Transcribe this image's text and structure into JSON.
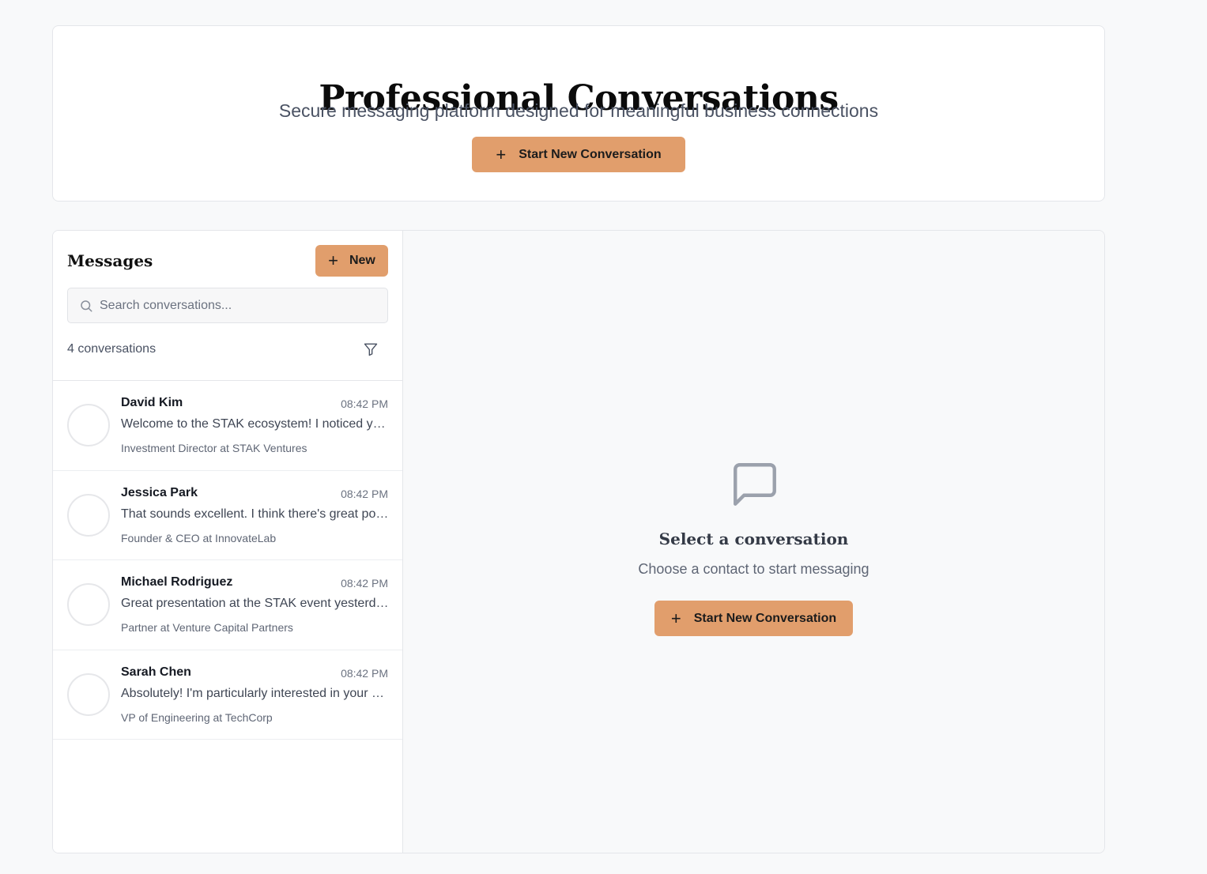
{
  "hero": {
    "title": "Professional Conversations",
    "subtitle": "Secure messaging platform designed for meaningful business connections",
    "cta_label": "Start New Conversation",
    "cta_icon": "plus-icon"
  },
  "sidebar": {
    "title": "Messages",
    "new_button_label": "New",
    "new_button_icon": "plus-icon",
    "search": {
      "placeholder": "Search conversations...",
      "value": "",
      "icon": "search-icon"
    },
    "count_text": "4 conversations",
    "filter_icon": "filter-icon",
    "conversations": [
      {
        "name": "David Kim",
        "time": "08:42 PM",
        "preview": "Welcome to the STAK ecosystem! I noticed your work in AI and would love to connect.",
        "role": "Investment Director at STAK Ventures"
      },
      {
        "name": "Jessica Park",
        "time": "08:42 PM",
        "preview": "That sounds excellent. I think there's great potential for collaboration here.",
        "role": "Founder & CEO at InnovateLab"
      },
      {
        "name": "Michael Rodriguez",
        "time": "08:42 PM",
        "preview": "Great presentation at the STAK event yesterday! Would love to follow up.",
        "role": "Partner at Venture Capital Partners"
      },
      {
        "name": "Sarah Chen",
        "time": "08:42 PM",
        "preview": "Absolutely! I'm particularly interested in your approach to scaling teams.",
        "role": "VP of Engineering at TechCorp"
      }
    ]
  },
  "main": {
    "empty_icon": "message-square-icon",
    "empty_title": "Select a conversation",
    "empty_subtitle": "Choose a contact to start messaging",
    "cta_label": "Start New Conversation",
    "cta_icon": "plus-icon"
  },
  "colors": {
    "accent": "#e19e6c",
    "background": "#f8f9fa",
    "card": "#ffffff",
    "border": "#e4e6ea"
  }
}
